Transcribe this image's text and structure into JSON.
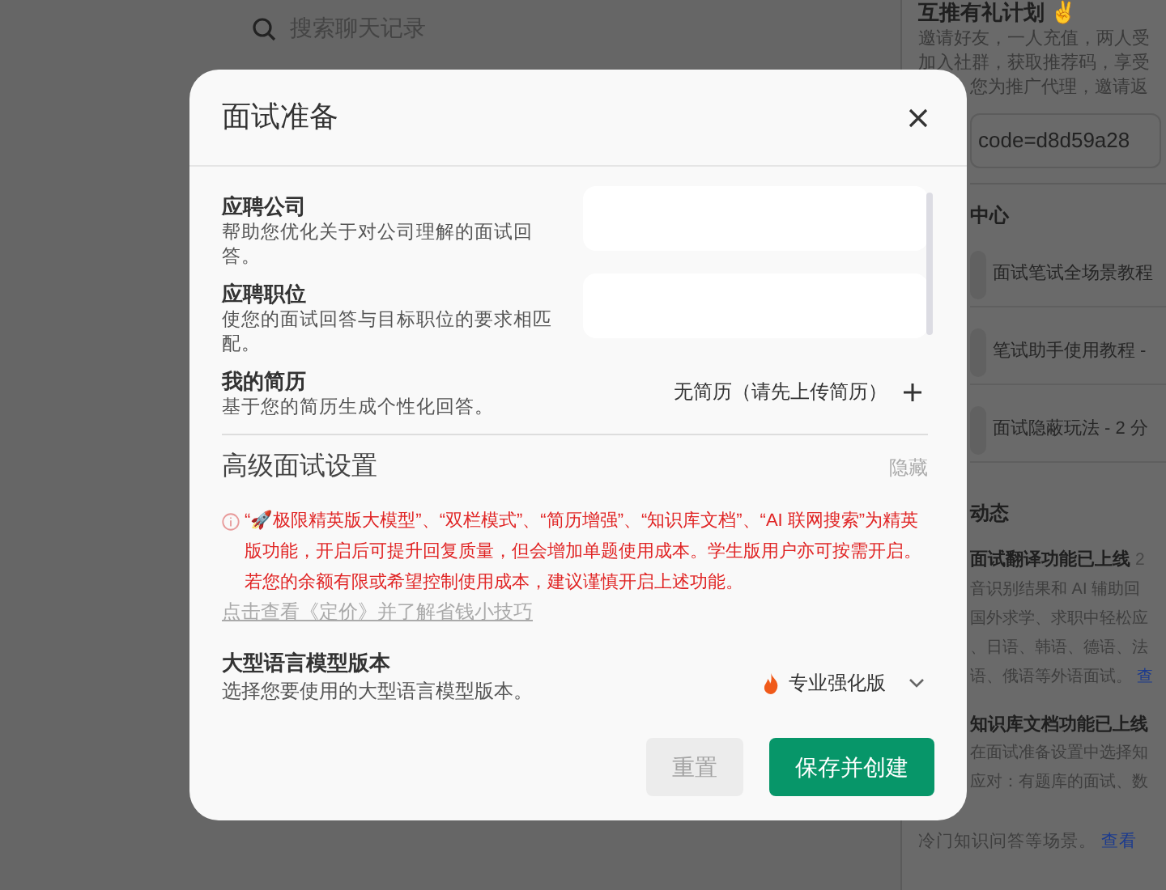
{
  "search": {
    "placeholder": "搜索聊天记录"
  },
  "side_panel": {
    "referral": {
      "title": "互推有礼计划 ✌",
      "lines": [
        "邀请好友，一人充值，两人受",
        "加入社群，获取推荐码，享受",
        "您为推广代理，邀请返"
      ],
      "code": "code=d8d59a28"
    },
    "help": {
      "title": "中心",
      "items": [
        "面试笔试全场景教程",
        "笔试助手使用教程 -",
        "面试隐蔽玩法 - 2 分"
      ]
    },
    "news": {
      "title": "动态",
      "posts": [
        {
          "title": "面试翻译功能已上线",
          "date": "2",
          "lines": [
            "音识别结果和 AI 辅助回",
            "国外求学、求职中轻松应",
            "、日语、韩语、德语、法",
            "语、俄语等外语面试。"
          ],
          "link": "查"
        },
        {
          "title": "知识库文档功能已上线",
          "lines": [
            "在面试准备设置中选择知",
            "应对：有题库的面试、数",
            "冷门知识问答等场景。"
          ],
          "link": "查看"
        }
      ]
    }
  },
  "dialog": {
    "title": "面试准备",
    "fields": [
      {
        "kind": "input",
        "label": "应聘公司",
        "hint": "帮助您优化关于对公司理解的面试回答。"
      },
      {
        "kind": "input",
        "label": "应聘职位",
        "hint": "使您的面试回答与目标职位的要求相匹配。"
      },
      {
        "kind": "resume",
        "label": "我的简历",
        "hint": "基于您的简历生成个性化回答。",
        "value": "无简历（请先上传简历）"
      }
    ],
    "advanced": {
      "title": "高级面试设置",
      "toggle": "隐藏",
      "notice": "“🚀极限精英版大模型”、“双栏模式”、“简历增强”、“知识库文档”、“AI 联网搜索”为精英版功能，开启后可提升回复质量，但会增加单题使用成本。学生版用户亦可按需开启。若您的余额有限或希望控制使用成本，建议谨慎开启上述功能。",
      "link": "点击查看《定价》并了解省钱小技巧",
      "model": {
        "label": "大型语言模型版本",
        "hint": "选择您要使用的大型语言模型版本。",
        "value": "专业强化版"
      }
    },
    "buttons": [
      {
        "label": "重置",
        "disabled": true
      },
      {
        "label": "保存并创建",
        "disabled": false
      }
    ]
  }
}
